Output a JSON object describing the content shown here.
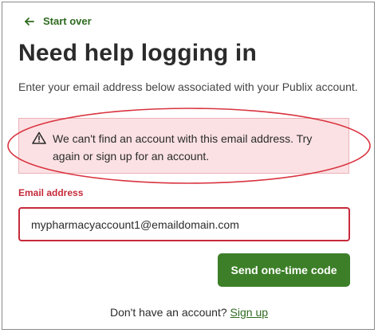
{
  "nav": {
    "start_over_label": "Start over",
    "back_icon": "arrow-left-icon"
  },
  "page": {
    "title": "Need help logging in",
    "intro": "Enter your email address below associated with your Publix account."
  },
  "error": {
    "icon": "warning-triangle-icon",
    "message": "We can't find an account with this email address. Try again or sign up for an account."
  },
  "form": {
    "email_label": "Email address",
    "email_value": "mypharmacyaccount1@emaildomain.com",
    "submit_label": "Send one-time code"
  },
  "footer": {
    "prompt": "Don't have an account?",
    "signup_label": "Sign up"
  },
  "colors": {
    "brand_green": "#3d7f28",
    "link_green": "#2f6b1f",
    "error_red": "#c62a3a",
    "error_bg": "#fbe1e3",
    "annotation_red": "#d9333f"
  }
}
